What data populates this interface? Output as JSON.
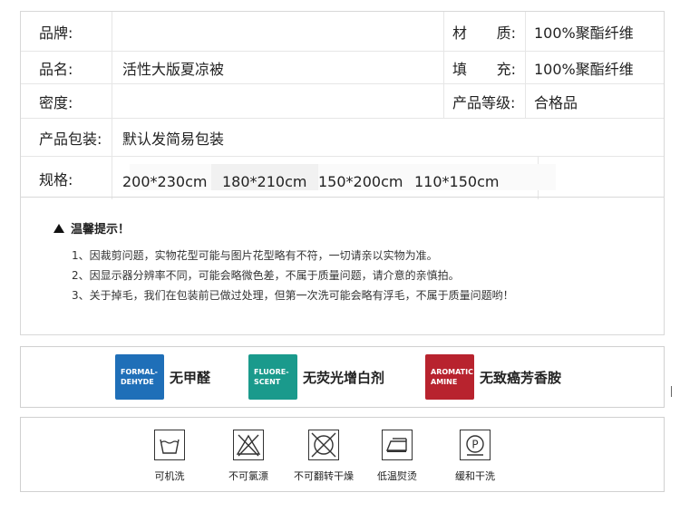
{
  "spec": {
    "brand_label": "品牌:",
    "material_label_a": "材",
    "material_label_b": "质:",
    "material_value": "100%聚酯纤维",
    "name_label": "品名:",
    "name_value": "活性大版夏凉被",
    "fill_label_a": "填",
    "fill_label_b": "充:",
    "fill_value": "100%聚酯纤维",
    "density_label": "密度:",
    "grade_label": "产品等级:",
    "grade_value": "合格品",
    "package_label": "产品包装:",
    "package_value": "默认发简易包装",
    "size_label": "规格:",
    "sizes": [
      "200*230cm",
      "180*210cm",
      "150*200cm",
      "110*150cm"
    ]
  },
  "tips": {
    "title": "温馨提示！",
    "lines": [
      "1、因裁剪问题，实物花型可能与图片花型略有不符，一切请亲以实物为准。",
      "2、因显示器分辨率不同，可能会略微色差，不属于质量问题，请介意的亲慎拍。",
      "3、关于掉毛，我们在包装前已做过处理，但第一次洗可能会略有浮毛，不属于质量问题哟！"
    ]
  },
  "badges": [
    {
      "tile_line1": "FORMAL-",
      "tile_line2": "DEHYDE",
      "text": "无甲醛",
      "color": "#1f6fb8"
    },
    {
      "tile_line1": "FLUORE-",
      "tile_line2": "SCENT",
      "text": "无荧光增白剂",
      "color": "#1a9a8c"
    },
    {
      "tile_line1": "AROMATIC",
      "tile_line2": "AMINE",
      "text": "无致癌芳香胺",
      "color": "#b8232e"
    }
  ],
  "care": [
    {
      "icon": "machine-wash-icon",
      "label": "可机洗"
    },
    {
      "icon": "no-bleach-icon",
      "label": "不可氯漂"
    },
    {
      "icon": "no-tumble-dry-icon",
      "label": "不可翻转干燥"
    },
    {
      "icon": "low-iron-icon",
      "label": "低温熨烫"
    },
    {
      "icon": "gentle-dry-clean-icon",
      "label": "缓和干洗"
    }
  ]
}
